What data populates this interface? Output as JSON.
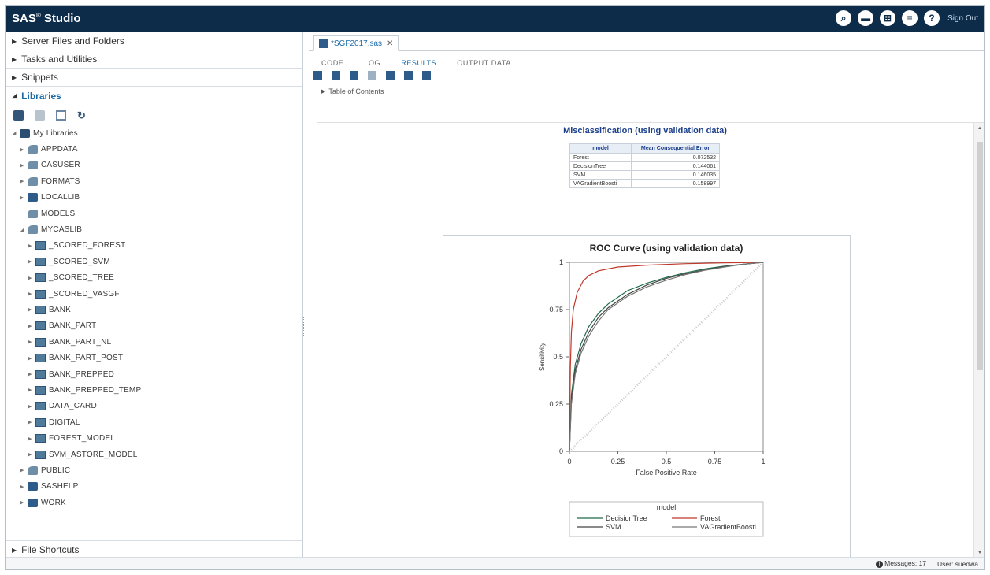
{
  "app": {
    "brand_name": "SAS",
    "brand_product": "Studio",
    "sign_out": "Sign Out"
  },
  "header": {
    "icons": [
      "search-icon",
      "folder-icon",
      "grid-icon",
      "menu-icon",
      "help-icon"
    ]
  },
  "leftpane": {
    "sections": {
      "server_files": "Server Files and Folders",
      "tasks": "Tasks and Utilities",
      "snippets": "Snippets",
      "libraries": "Libraries",
      "file_shortcuts": "File Shortcuts"
    },
    "tree": {
      "root": "My Libraries",
      "nodes": [
        {
          "label": "APPDATA",
          "kind": "cas",
          "indent": 1
        },
        {
          "label": "CASUSER",
          "kind": "cas",
          "indent": 1
        },
        {
          "label": "FORMATS",
          "kind": "cas",
          "indent": 1
        },
        {
          "label": "LOCALLIB",
          "kind": "lib",
          "indent": 1
        },
        {
          "label": "MODELS",
          "kind": "cas",
          "indent": 1
        },
        {
          "label": "MYCASLIB",
          "kind": "cas",
          "indent": 1
        },
        {
          "label": "_SCORED_FOREST",
          "kind": "tbl",
          "indent": 2
        },
        {
          "label": "_SCORED_SVM",
          "kind": "tbl",
          "indent": 2
        },
        {
          "label": "_SCORED_TREE",
          "kind": "tbl",
          "indent": 2
        },
        {
          "label": "_SCORED_VASGF",
          "kind": "tbl",
          "indent": 2
        },
        {
          "label": "BANK",
          "kind": "tbl",
          "indent": 2
        },
        {
          "label": "BANK_PART",
          "kind": "tbl",
          "indent": 2
        },
        {
          "label": "BANK_PART_NL",
          "kind": "tbl",
          "indent": 2
        },
        {
          "label": "BANK_PART_POST",
          "kind": "tbl",
          "indent": 2
        },
        {
          "label": "BANK_PREPPED",
          "kind": "tbl",
          "indent": 2
        },
        {
          "label": "BANK_PREPPED_TEMP",
          "kind": "tbl",
          "indent": 2
        },
        {
          "label": "DATA_CARD",
          "kind": "tbl",
          "indent": 2
        },
        {
          "label": "DIGITAL",
          "kind": "tbl",
          "indent": 2
        },
        {
          "label": "FOREST_MODEL",
          "kind": "tbl",
          "indent": 2
        },
        {
          "label": "SVM_ASTORE_MODEL",
          "kind": "tbl",
          "indent": 2
        },
        {
          "label": "PUBLIC",
          "kind": "cas",
          "indent": 1
        },
        {
          "label": "SASHELP",
          "kind": "lib",
          "indent": 1
        },
        {
          "label": "WORK",
          "kind": "lib",
          "indent": 1
        }
      ]
    }
  },
  "editor": {
    "file_tab": "*SGF2017.sas",
    "subtabs": [
      "CODE",
      "LOG",
      "RESULTS",
      "OUTPUT DATA"
    ],
    "active_subtab": "RESULTS",
    "toc": "Table of Contents"
  },
  "results": {
    "misclass_title": "Misclassification (using validation data)",
    "table": {
      "headers": [
        "model",
        "Mean Consequential Error"
      ],
      "rows": [
        [
          "Forest",
          "0.072532"
        ],
        [
          "DecisionTree",
          "0.144061"
        ],
        [
          "SVM",
          "0.146035"
        ],
        [
          "VAGradientBoosti",
          "0.158997"
        ]
      ]
    }
  },
  "chart_data": {
    "type": "line",
    "title": "ROC Curve (using validation data)",
    "xlabel": "False Positive Rate",
    "ylabel": "Sensitivity",
    "xlim": [
      0,
      1
    ],
    "ylim": [
      0,
      1
    ],
    "xticks": [
      "0",
      "0.25",
      "0.5",
      "0.75",
      "1"
    ],
    "yticks": [
      "0",
      "0.25",
      "0.5",
      "0.75",
      "1"
    ],
    "legend_title": "model",
    "legend_placement": "bottom",
    "series": [
      {
        "name": "DecisionTree",
        "color": "#1f6b4a",
        "points": [
          [
            0,
            0
          ],
          [
            0.01,
            0.3
          ],
          [
            0.03,
            0.46
          ],
          [
            0.06,
            0.57
          ],
          [
            0.1,
            0.66
          ],
          [
            0.15,
            0.73
          ],
          [
            0.2,
            0.78
          ],
          [
            0.3,
            0.85
          ],
          [
            0.4,
            0.89
          ],
          [
            0.5,
            0.92
          ],
          [
            0.6,
            0.945
          ],
          [
            0.7,
            0.965
          ],
          [
            0.8,
            0.98
          ],
          [
            0.9,
            0.99
          ],
          [
            1,
            1
          ]
        ]
      },
      {
        "name": "Forest",
        "color": "#c0392b",
        "points": [
          [
            0,
            0
          ],
          [
            0.005,
            0.45
          ],
          [
            0.01,
            0.63
          ],
          [
            0.02,
            0.75
          ],
          [
            0.04,
            0.84
          ],
          [
            0.07,
            0.9
          ],
          [
            0.1,
            0.93
          ],
          [
            0.15,
            0.955
          ],
          [
            0.25,
            0.975
          ],
          [
            0.4,
            0.985
          ],
          [
            0.6,
            0.993
          ],
          [
            0.8,
            0.997
          ],
          [
            1,
            1
          ]
        ]
      },
      {
        "name": "SVM",
        "color": "#444444",
        "points": [
          [
            0,
            0
          ],
          [
            0.01,
            0.27
          ],
          [
            0.03,
            0.43
          ],
          [
            0.06,
            0.54
          ],
          [
            0.1,
            0.63
          ],
          [
            0.15,
            0.71
          ],
          [
            0.2,
            0.76
          ],
          [
            0.3,
            0.83
          ],
          [
            0.4,
            0.88
          ],
          [
            0.5,
            0.915
          ],
          [
            0.6,
            0.94
          ],
          [
            0.7,
            0.96
          ],
          [
            0.8,
            0.977
          ],
          [
            0.9,
            0.99
          ],
          [
            1,
            1
          ]
        ]
      },
      {
        "name": "VAGradientBoosti",
        "color": "#777777",
        "points": [
          [
            0,
            0
          ],
          [
            0.01,
            0.25
          ],
          [
            0.03,
            0.41
          ],
          [
            0.06,
            0.52
          ],
          [
            0.1,
            0.61
          ],
          [
            0.15,
            0.69
          ],
          [
            0.2,
            0.75
          ],
          [
            0.3,
            0.82
          ],
          [
            0.4,
            0.87
          ],
          [
            0.5,
            0.905
          ],
          [
            0.6,
            0.935
          ],
          [
            0.7,
            0.958
          ],
          [
            0.8,
            0.975
          ],
          [
            0.9,
            0.99
          ],
          [
            1,
            1
          ]
        ]
      }
    ],
    "reference_line": true
  },
  "status": {
    "messages": "Messages: 17",
    "user": "User: suedwa"
  }
}
